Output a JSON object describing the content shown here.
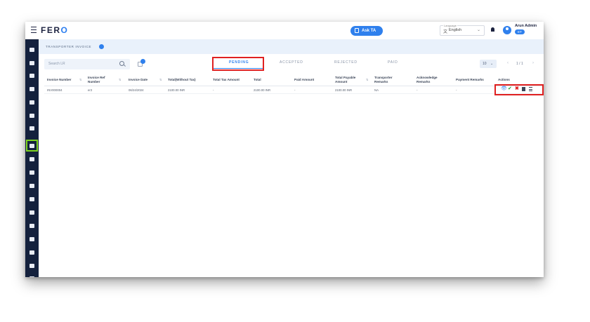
{
  "app": {
    "logo": "FER",
    "logo_accent": "O",
    "menu_icon": "hamburger-icon"
  },
  "header": {
    "ask_button": "Ask TA",
    "language_caption": "Language",
    "language_value": "English",
    "user_name": "Arun Admin",
    "user_badge": "ET"
  },
  "breadcrumb": "TRANSPORTER INVOICE",
  "search": {
    "placeholder": "Search LR"
  },
  "tabs": [
    {
      "label": "PENDING",
      "active": true
    },
    {
      "label": "ACCEPTED",
      "active": false
    },
    {
      "label": "REJECTED",
      "active": false
    },
    {
      "label": "PAID",
      "active": false
    }
  ],
  "pager": {
    "page_size": "10",
    "page_text": "1 / 1"
  },
  "table": {
    "columns": [
      "Invoice Number",
      "Invoice Ref Number",
      "Invoice Date",
      "Total(Without Tax)",
      "Total Tax Amount",
      "Total",
      "Paid Amount",
      "Total Payable Amount",
      "Transporter Remarks",
      "Acknowledge Remarks",
      "Payment Remarks",
      "Actions"
    ],
    "rows": [
      [
        "INV000004",
        "er2",
        "06/24/2024",
        "2100.00 INR",
        "-",
        "2100.00 INR",
        "-",
        "2100.00 INR",
        "NA",
        "-",
        "-",
        ""
      ]
    ]
  },
  "actions": [
    "eye-icon",
    "check-icon",
    "close-icon",
    "document-icon",
    "list-icon"
  ],
  "colors": {
    "sidebar": "#14213d",
    "accent": "#2f80ed",
    "highlight_red": "#e02020",
    "highlight_green": "#7ed321"
  }
}
